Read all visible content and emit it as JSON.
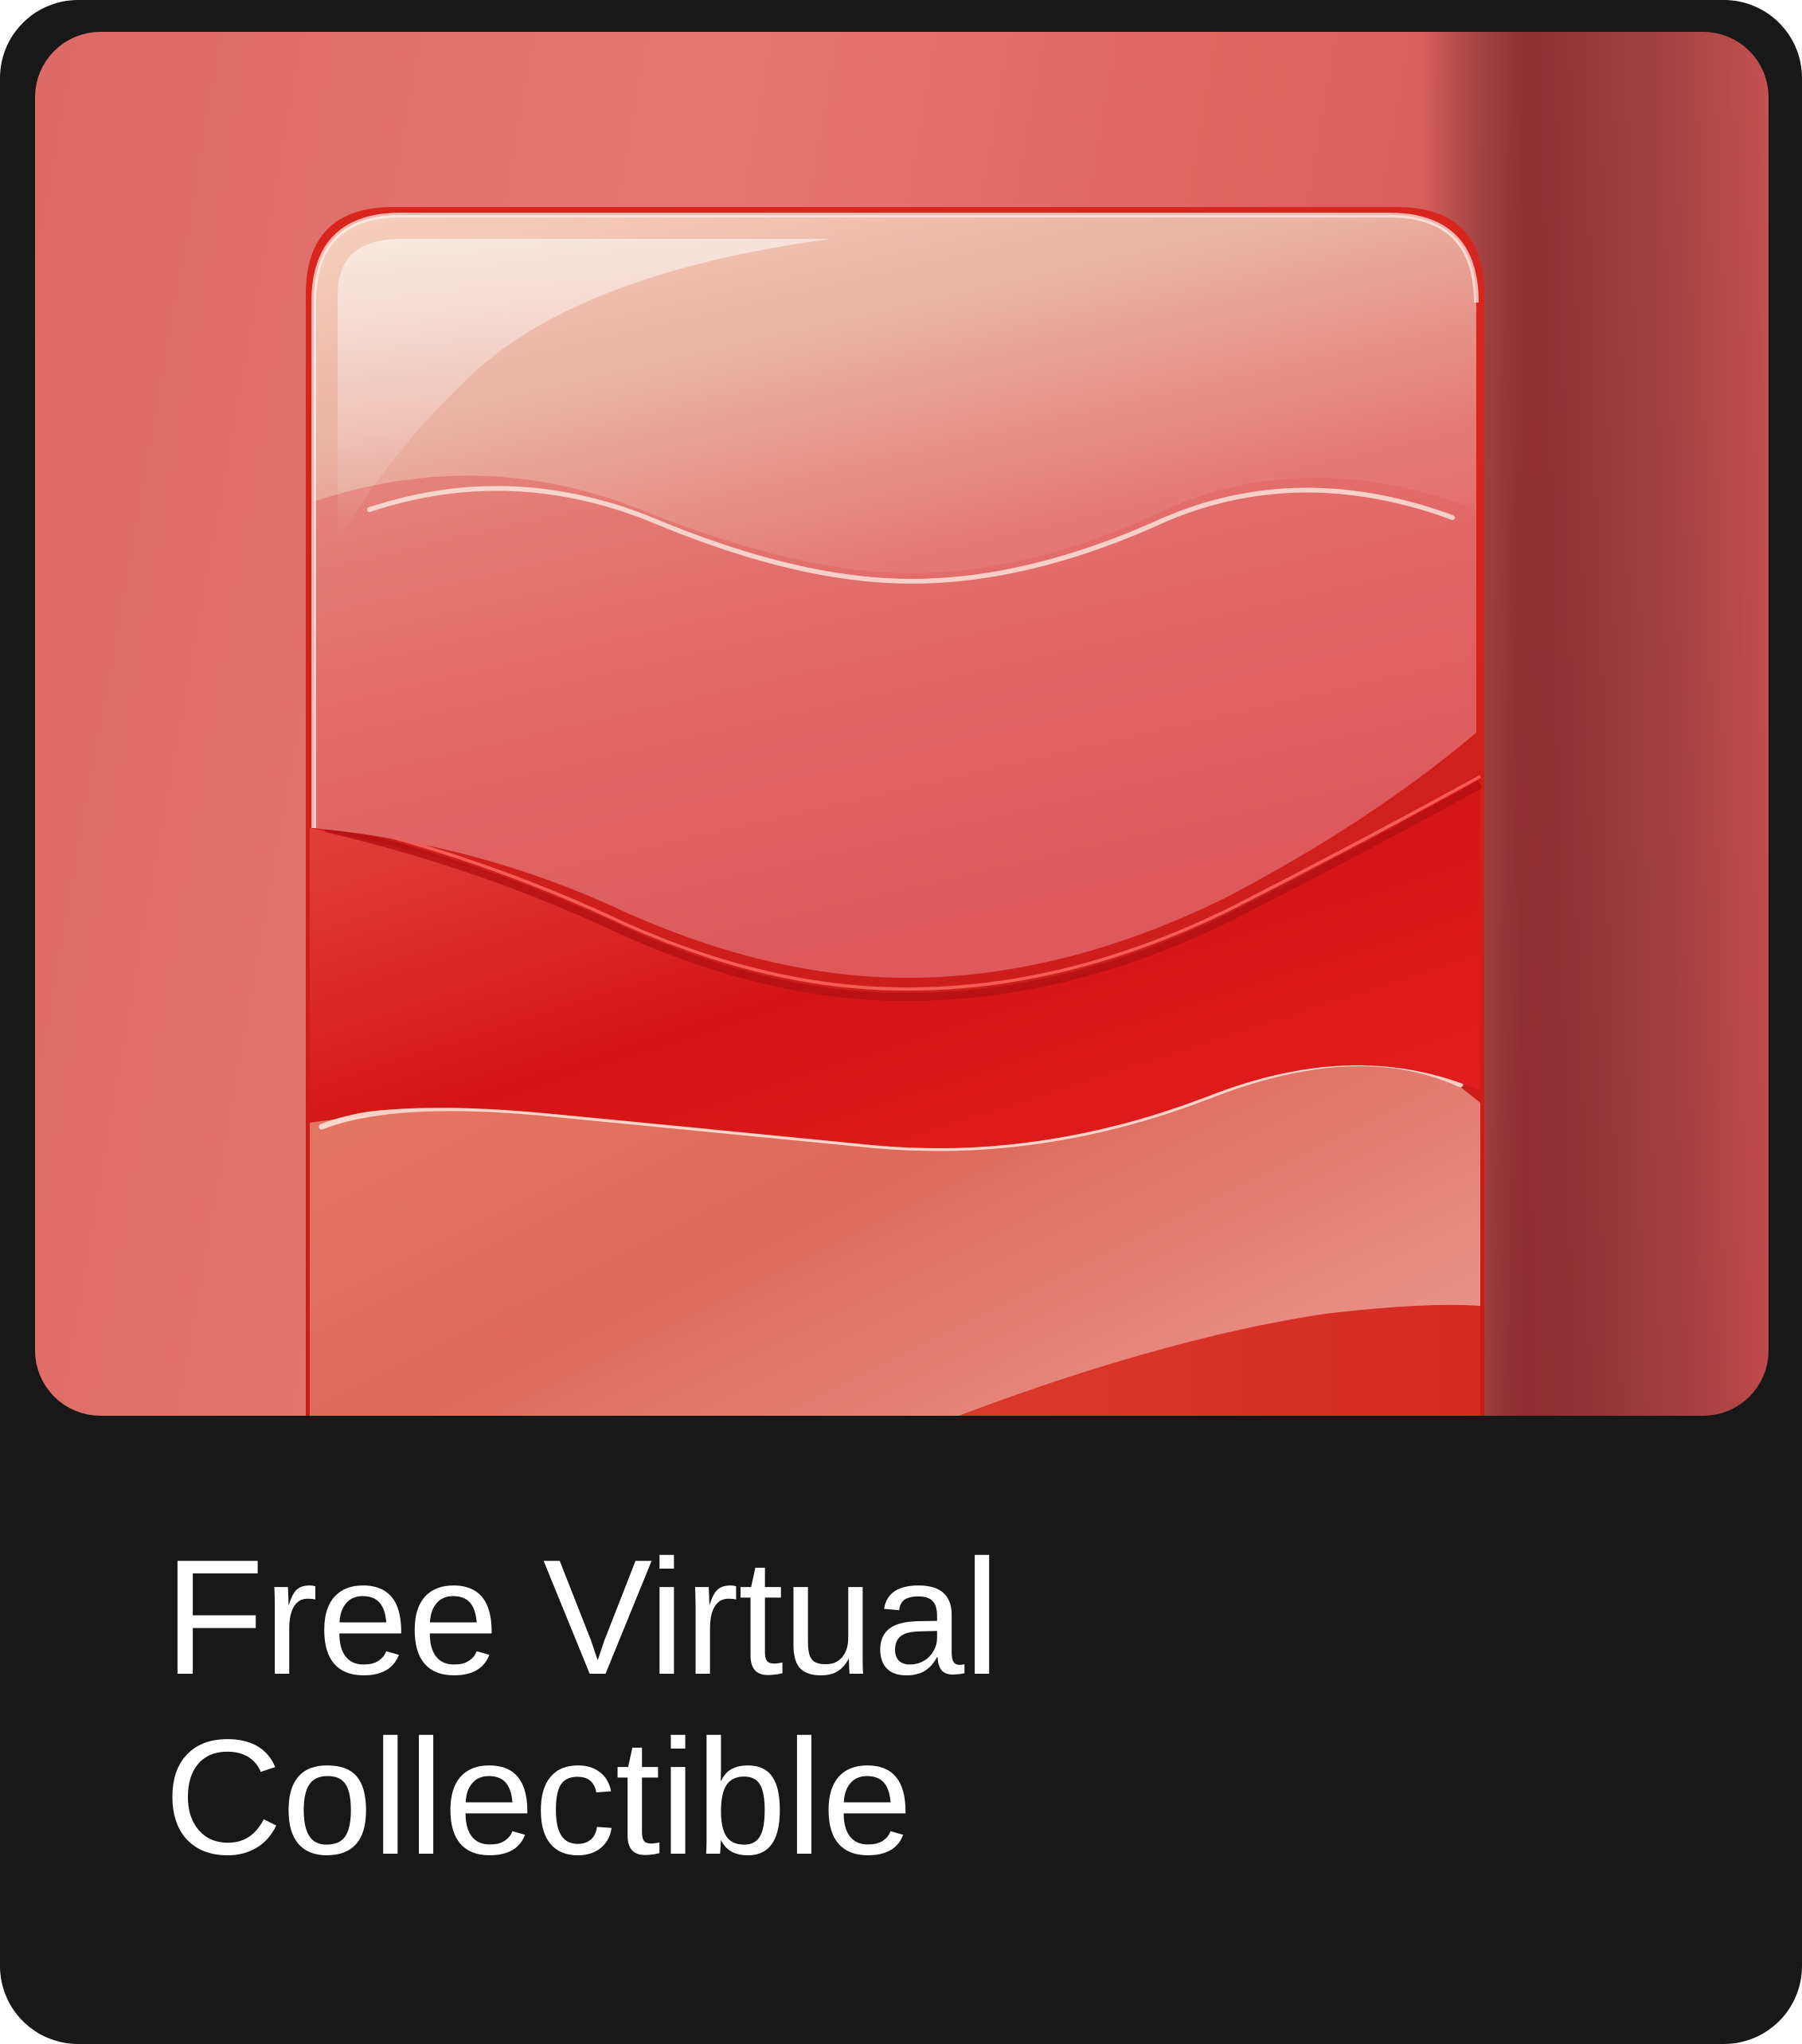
{
  "card": {
    "title_line_1": "Free Virtual",
    "title_line_2": "Collectible"
  },
  "artwork": {
    "icon": "wavy-glossy-tile-icon",
    "colors": {
      "frame_background": "#1a1a1a",
      "art_background": "#e0706c",
      "tile_top": "#efc4b0",
      "tile_mid": "#e05a5e",
      "tile_deep_red": "#d81b1b",
      "tile_bottom": "#e26a5a",
      "title_text": "#ffffff"
    }
  }
}
